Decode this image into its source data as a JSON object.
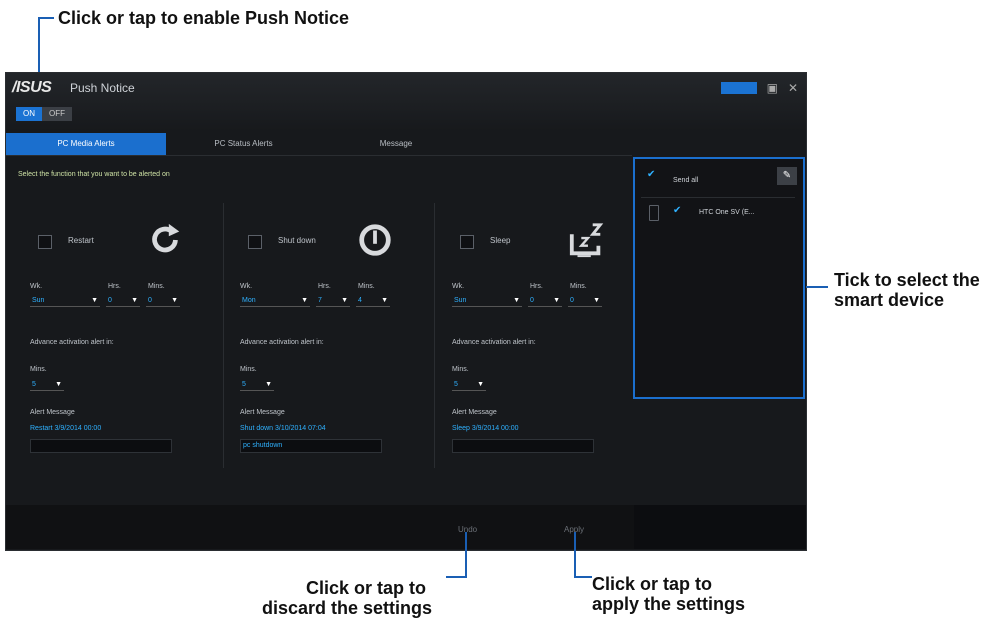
{
  "callouts": {
    "enable": "Click or tap to enable Push Notice",
    "select_device_1": "Tick to select the",
    "select_device_2": "smart device",
    "discard_1": "Click or tap to",
    "discard_2": "discard the settings",
    "apply_1": "Click or tap to",
    "apply_2": "apply the settings"
  },
  "window": {
    "logo": "/ISUS",
    "title": "Push Notice",
    "toggle_on": "ON",
    "toggle_off": "OFF"
  },
  "tabs": [
    {
      "label": "PC Media Alerts"
    },
    {
      "label": "PC Status Alerts"
    },
    {
      "label": "Message"
    }
  ],
  "intro": "Select the function that you want to be alerted on",
  "columns": [
    {
      "label": "Restart",
      "wk_label": "Wk.",
      "hrs_label": "Hrs.",
      "mins_label": "Mins.",
      "wk": "Sun",
      "hrs": "0",
      "mins": "0",
      "advance_label": "Advance activation alert in:",
      "adv_mins_label": "Mins.",
      "adv_mins": "5",
      "alert_label": "Alert Message",
      "alert_preview": "Restart 3/9/2014 00:00",
      "alert_message": ""
    },
    {
      "label": "Shut down",
      "wk_label": "Wk.",
      "hrs_label": "Hrs.",
      "mins_label": "Mins.",
      "wk": "Mon",
      "hrs": "7",
      "mins": "4",
      "advance_label": "Advance activation alert in:",
      "adv_mins_label": "Mins.",
      "adv_mins": "5",
      "alert_label": "Alert Message",
      "alert_preview": "Shut down 3/10/2014 07:04",
      "alert_message": "pc shutdown"
    },
    {
      "label": "Sleep",
      "wk_label": "Wk.",
      "hrs_label": "Hrs.",
      "mins_label": "Mins.",
      "wk": "Sun",
      "hrs": "0",
      "mins": "0",
      "advance_label": "Advance activation alert in:",
      "adv_mins_label": "Mins.",
      "adv_mins": "5",
      "alert_label": "Alert Message",
      "alert_preview": "Sleep 3/9/2014 00:00",
      "alert_message": ""
    }
  ],
  "devices": {
    "select_all": "Send all",
    "item": "HTC One SV (E..."
  },
  "footer": {
    "undo": "Undo",
    "apply": "Apply"
  },
  "colors": {
    "accent": "#1b6fce",
    "window_bg": "#17191c",
    "value_text": "#2fb1ff"
  }
}
